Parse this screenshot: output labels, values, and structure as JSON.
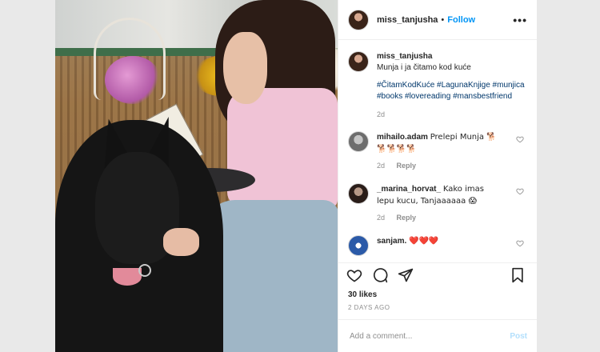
{
  "header": {
    "username": "miss_tanjusha",
    "separator": "•",
    "follow_label": "Follow",
    "more_icon": "more-dots-icon",
    "more_glyph": "•••"
  },
  "caption": {
    "username": "miss_tanjusha",
    "text": "Munja i ja čitamo kod kuće",
    "hashtags": "#ČitamKodKuće #LagunaKnjige #munjica #books #lovereading #mansbestfriend",
    "age": "2d"
  },
  "comments": [
    {
      "username": "mihailo.adam",
      "text": "Prelepi Munja 🐕 🐕🐕🐕🐕",
      "age": "2d",
      "reply": "Reply"
    },
    {
      "username": "_marina_horvat_",
      "text": "Kako imas lepu kucu, Tanjaaaaaa 😱",
      "age": "2d",
      "reply": "Reply"
    },
    {
      "username": "sanjam.",
      "text": "❤️❤️❤️",
      "age": "",
      "reply": ""
    }
  ],
  "actions": {
    "like_icon": "heart-icon",
    "comment_icon": "comment-icon",
    "share_icon": "share-icon",
    "save_icon": "bookmark-icon"
  },
  "likes": "30 likes",
  "posted_ago": "2 DAYS AGO",
  "add_comment": {
    "placeholder": "Add a comment...",
    "post_label": "Post"
  },
  "colors": {
    "link": "#0095f6",
    "hashtag": "#00376b",
    "muted": "#8e8e8e",
    "post_disabled": "#b2dffc"
  }
}
